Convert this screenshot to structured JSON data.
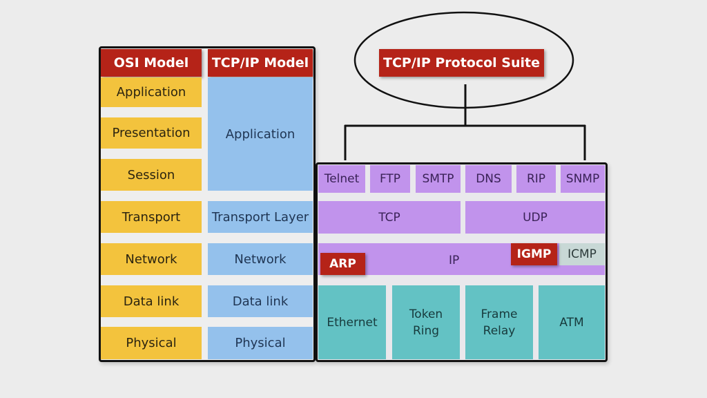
{
  "osi_model": {
    "header": "OSI Model",
    "layers": [
      "Application",
      "Presentation",
      "Session",
      "Transport",
      "Network",
      "Data link",
      "Physical"
    ]
  },
  "tcpip_model": {
    "header": "TCP/IP Model",
    "layers": [
      "Application",
      "Transport Layer",
      "Network",
      "Data link",
      "Physical"
    ]
  },
  "protocol_suite": {
    "title": "TCP/IP Protocol Suite",
    "application_protocols": [
      "Telnet",
      "FTP",
      "SMTP",
      "DNS",
      "RIP",
      "SNMP"
    ],
    "transport_protocols": [
      "TCP",
      "UDP"
    ],
    "network": {
      "main": "IP",
      "arp": "ARP",
      "igmp": "IGMP",
      "icmp": "ICMP"
    },
    "link_protocols": [
      "Ethernet",
      "Token\nRing",
      "Frame\nRelay",
      "ATM"
    ]
  },
  "colors": {
    "header_red": "#b52318",
    "osi_yellow": "#f3c33d",
    "tcpip_blue": "#94c1ec",
    "protocol_purple": "#c193ec",
    "icmp_grey": "#c8d8d6",
    "link_teal": "#63c2c4"
  }
}
